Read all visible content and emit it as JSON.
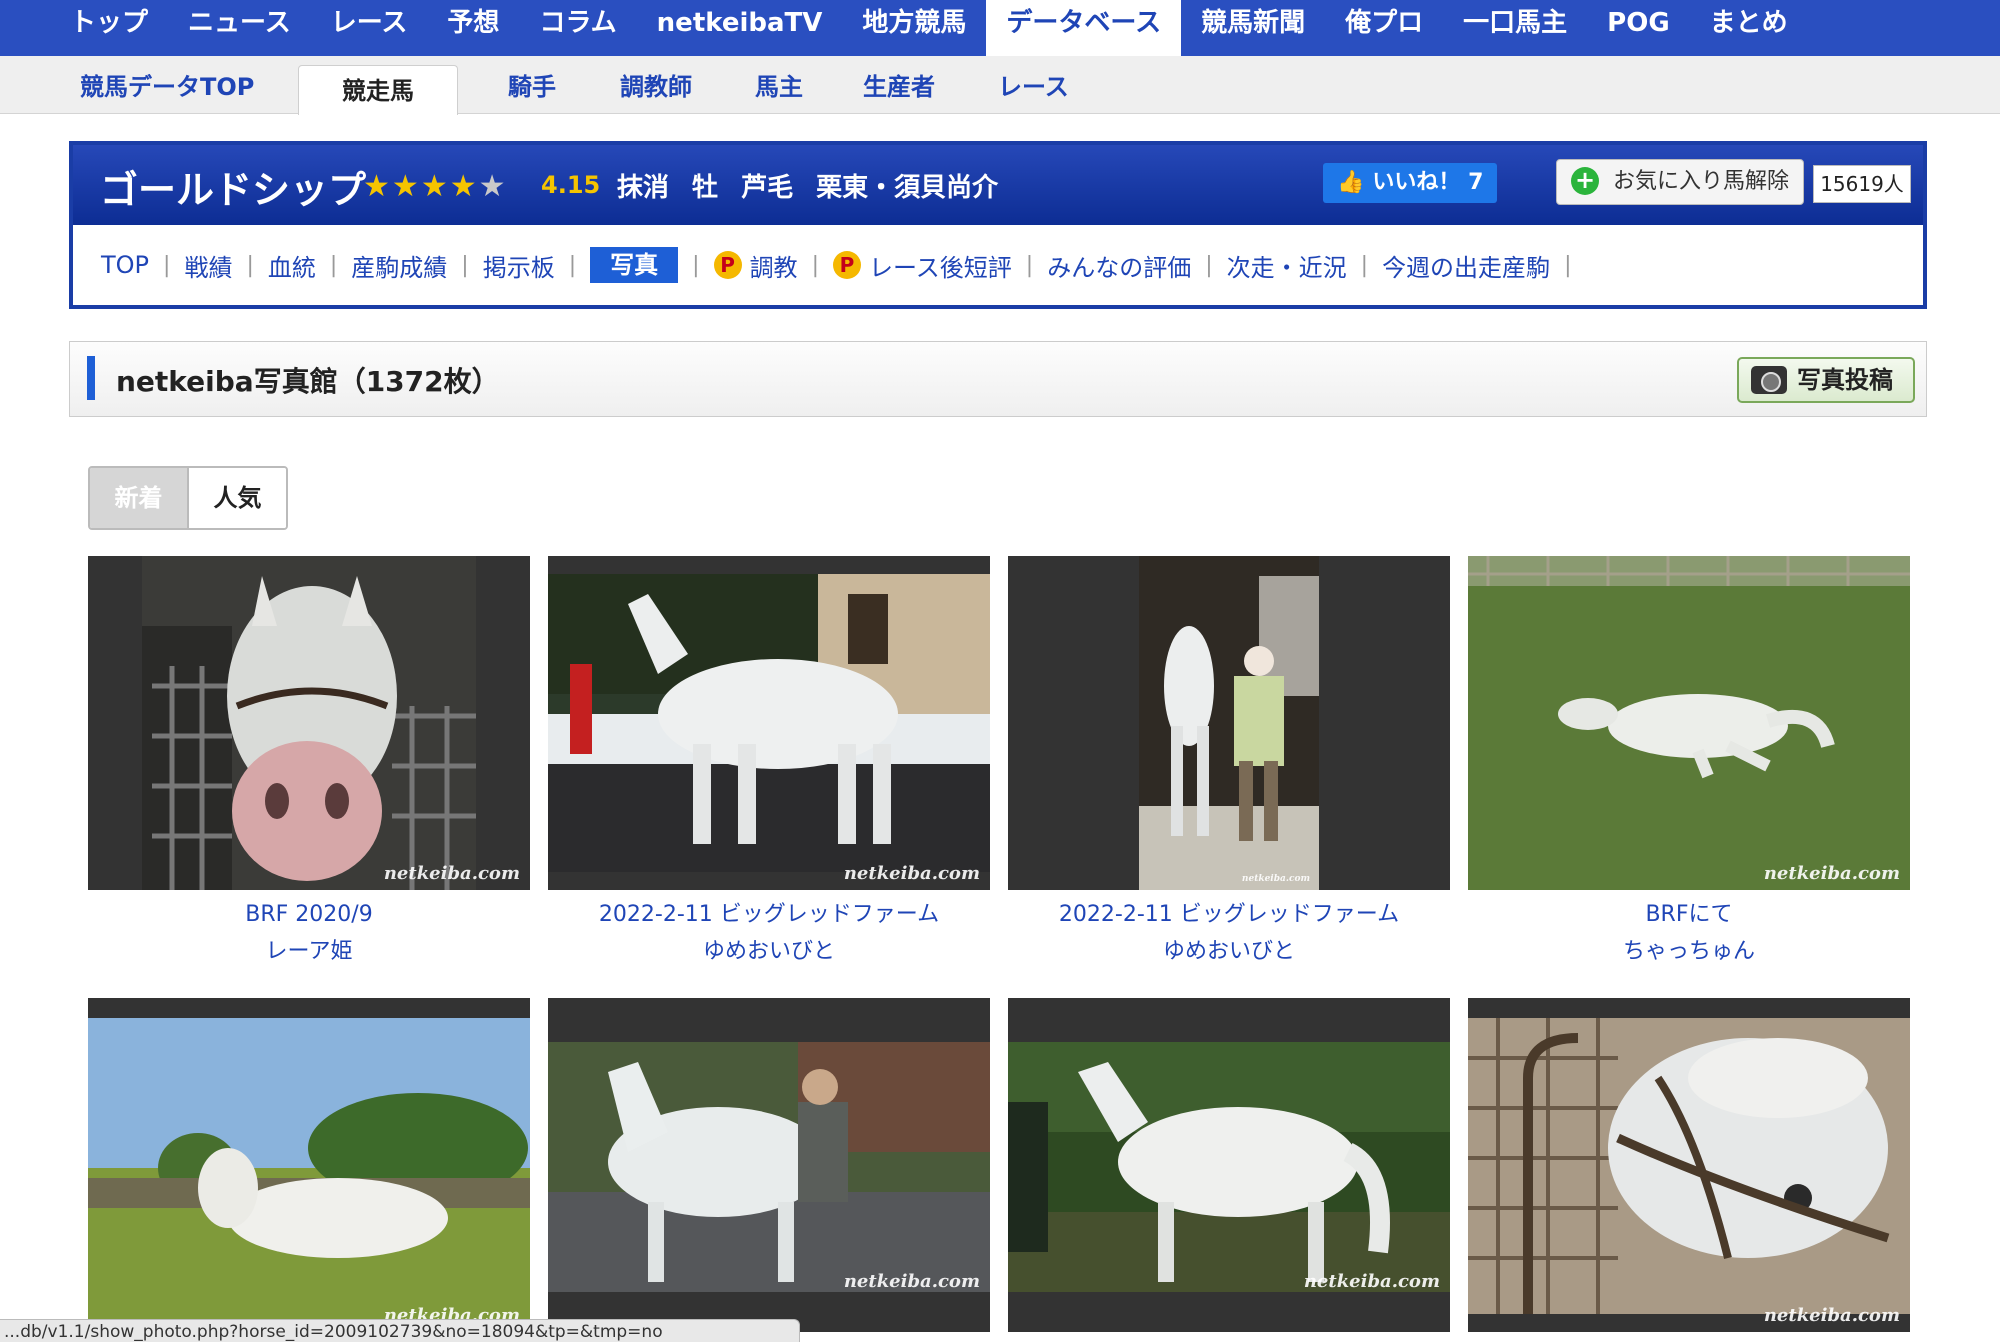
{
  "global_nav": [
    "トップ",
    "ニュース",
    "レース",
    "予想",
    "コラム",
    "netkeibaTV",
    "地方競馬",
    "データベース",
    "競馬新聞",
    "俺プロ",
    "一口馬主",
    "POG",
    "まとめ"
  ],
  "global_nav_active": "データベース",
  "sub_nav": [
    "競馬データTOP",
    "競走馬",
    "騎手",
    "調教師",
    "馬主",
    "生産者",
    "レース"
  ],
  "sub_nav_active": "競走馬",
  "horse": {
    "name": "ゴールドシップ",
    "star_count": 5,
    "star_filled": 4,
    "rating": "4.15",
    "meta": "抹消 牡 芦毛 栗東・須貝尚介",
    "like_label": "いいね！ 7",
    "fav_label": "お気に入り馬解除",
    "fav_count": "15619人"
  },
  "horse_tabs": [
    {
      "label": "TOP",
      "active": false,
      "premium": false
    },
    {
      "label": "戦績",
      "active": false,
      "premium": false
    },
    {
      "label": "血統",
      "active": false,
      "premium": false
    },
    {
      "label": "産駒成績",
      "active": false,
      "premium": false
    },
    {
      "label": "掲示板",
      "active": false,
      "premium": false
    },
    {
      "label": "写真",
      "active": true,
      "premium": false
    },
    {
      "label": "調教",
      "active": false,
      "premium": true
    },
    {
      "label": "レース後短評",
      "active": false,
      "premium": true
    },
    {
      "label": "みんなの評価",
      "active": false,
      "premium": false
    },
    {
      "label": "次走・近況",
      "active": false,
      "premium": false
    },
    {
      "label": "今週の出走産駒",
      "active": false,
      "premium": false
    }
  ],
  "premium_badge": "P",
  "gallery": {
    "title": "netkeiba写真館（1372枚）",
    "post_button": "写真投稿",
    "sort_new": "新着",
    "sort_popular": "人気",
    "watermark": "netkeiba.com"
  },
  "photos": [
    {
      "caption1": "BRF 2020/9",
      "caption2": "レーア姫"
    },
    {
      "caption1": "2022-2-11 ビッグレッドファーム",
      "caption2": "ゆめおいびと"
    },
    {
      "caption1": "2022-2-11 ビッグレッドファーム",
      "caption2": "ゆめおいびと"
    },
    {
      "caption1": "BRFにて",
      "caption2": "ちゃっちゅん"
    },
    {
      "caption1": "",
      "caption2": ""
    },
    {
      "caption1": "",
      "caption2": ""
    },
    {
      "caption1": "",
      "caption2": ""
    },
    {
      "caption1": "",
      "caption2": ""
    }
  ],
  "status_url": "...db/v1.1/show_photo.php?horse_id=2009102739&no=18094&tp=&tmp=no"
}
